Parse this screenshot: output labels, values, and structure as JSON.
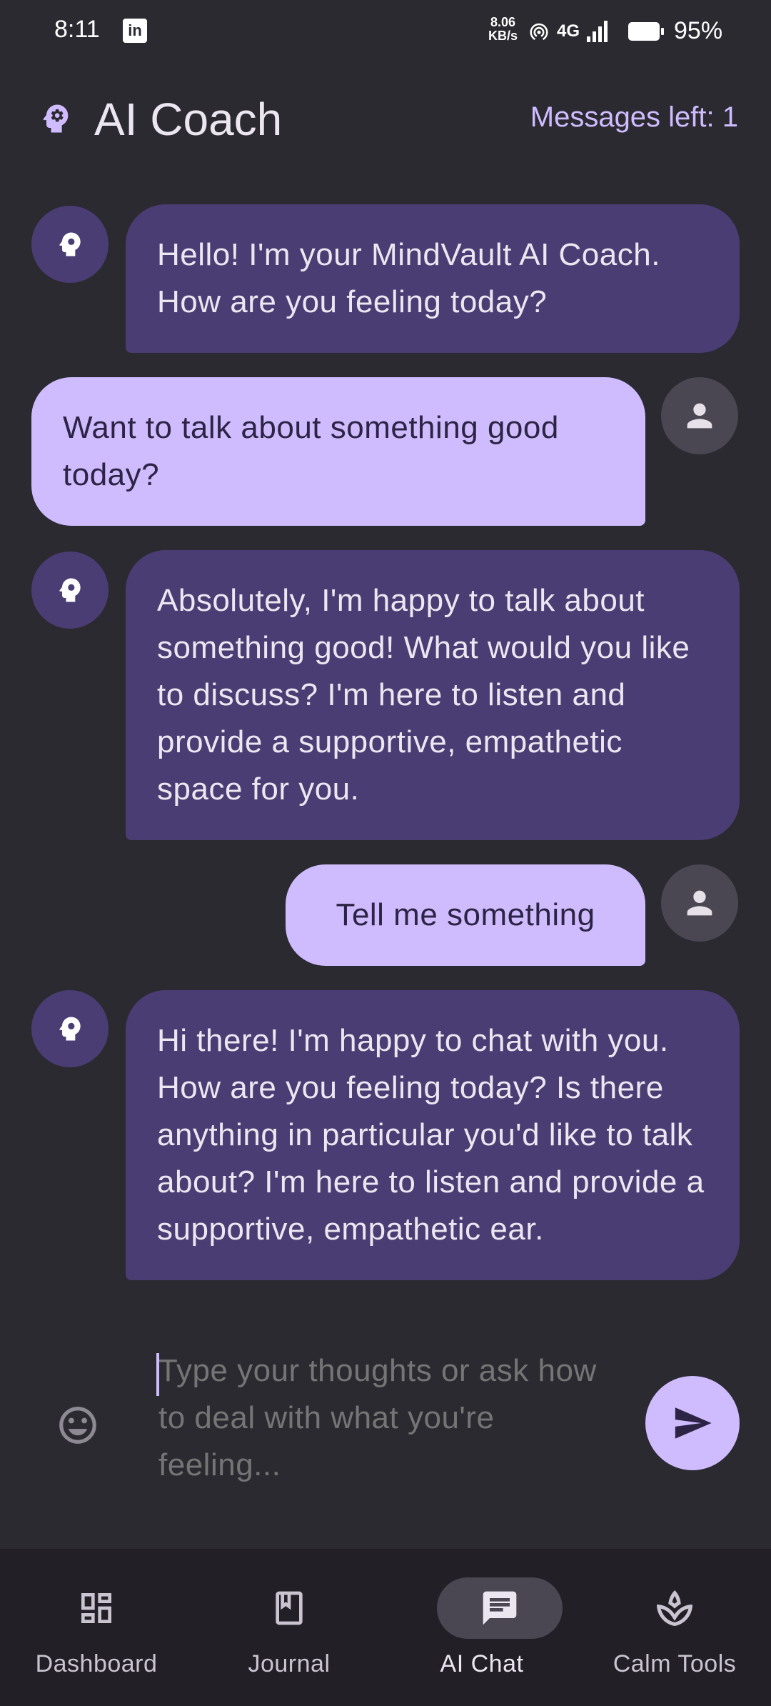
{
  "status_bar": {
    "time": "8:11",
    "net_speed_value": "8.06",
    "net_speed_unit": "KB/s",
    "network": "4G",
    "battery": "95%"
  },
  "app_bar": {
    "title": "AI Coach",
    "messages_left": "Messages left: 1"
  },
  "messages": [
    {
      "sender": "bot",
      "text": "Hello! I'm your MindVault AI Coach. How are you feeling today?"
    },
    {
      "sender": "user",
      "text": "Want to talk about something good today?"
    },
    {
      "sender": "bot",
      "text": "Absolutely, I'm happy to talk about something good! What would you like to discuss? I'm here to listen and provide a supportive, empathetic space for you."
    },
    {
      "sender": "user",
      "text": "Tell me something"
    },
    {
      "sender": "bot",
      "text": "Hi there! I'm happy to chat with you. How are you feeling today? Is there anything in particular you'd like to talk about? I'm here to listen and provide a supportive, empathetic ear."
    }
  ],
  "input": {
    "placeholder": "Type your thoughts or ask how to deal with what you're feeling...",
    "value": ""
  },
  "nav": {
    "items": [
      {
        "label": "Dashboard",
        "icon": "dashboard-icon"
      },
      {
        "label": "Journal",
        "icon": "book-icon"
      },
      {
        "label": "AI Chat",
        "icon": "chat-icon",
        "active": true
      },
      {
        "label": "Calm Tools",
        "icon": "spa-icon"
      }
    ]
  },
  "colors": {
    "background": "#2b2a31",
    "bot_bubble": "#4a3d74",
    "user_bubble": "#cfbcff",
    "accent": "#cfbcff",
    "nav_background": "#221f26"
  }
}
